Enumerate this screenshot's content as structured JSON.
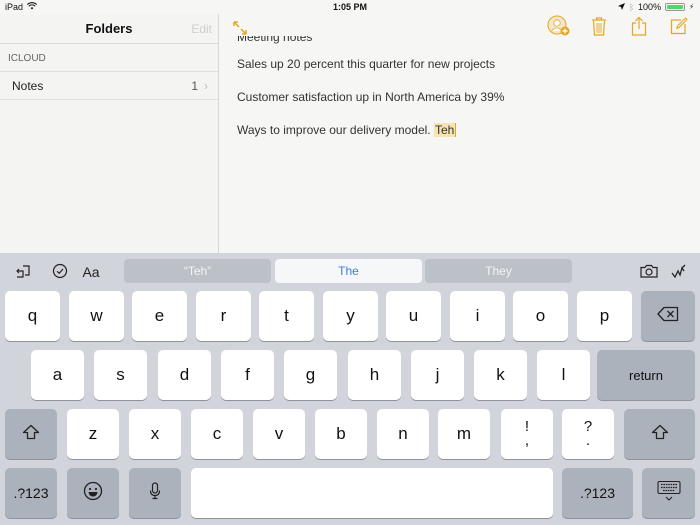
{
  "status_bar": {
    "device": "iPad",
    "time": "1:05 PM",
    "battery_percent": "100%",
    "battery_level": 1.0,
    "battery_color": "#4cd964"
  },
  "sidebar": {
    "title": "Folders",
    "edit_label": "Edit",
    "section_header": "ICLOUD",
    "folders": [
      {
        "name": "Notes",
        "count": "1"
      }
    ]
  },
  "note": {
    "accent_color": "#e6a623",
    "lines": [
      "Meeting notes",
      "Sales up 20 percent this quarter for new projects",
      "Customer satisfaction up in North America by 39%",
      "Ways to improve our delivery model."
    ],
    "highlighted_word": "Teh",
    "toolbar": [
      "add-people-icon",
      "trash-icon",
      "share-icon",
      "compose-icon"
    ]
  },
  "keyboard": {
    "shortcuts_left": [
      "undo-icon",
      "checklist-icon",
      "format-icon"
    ],
    "format_label": "Aa",
    "suggestions": [
      "“Teh”",
      "The",
      "They"
    ],
    "shortcuts_right": [
      "camera-icon",
      "sketch-icon"
    ],
    "rows": [
      [
        "q",
        "w",
        "e",
        "r",
        "t",
        "y",
        "u",
        "i",
        "o",
        "p"
      ],
      [
        "a",
        "s",
        "d",
        "f",
        "g",
        "h",
        "j",
        "k",
        "l"
      ],
      [
        "z",
        "x",
        "c",
        "v",
        "b",
        "n",
        "m"
      ]
    ],
    "punct_1": [
      "!",
      ","
    ],
    "punct_2": [
      "?",
      "."
    ],
    "return_label": "return",
    "numbers_label": ".?123",
    "space_label": ""
  }
}
